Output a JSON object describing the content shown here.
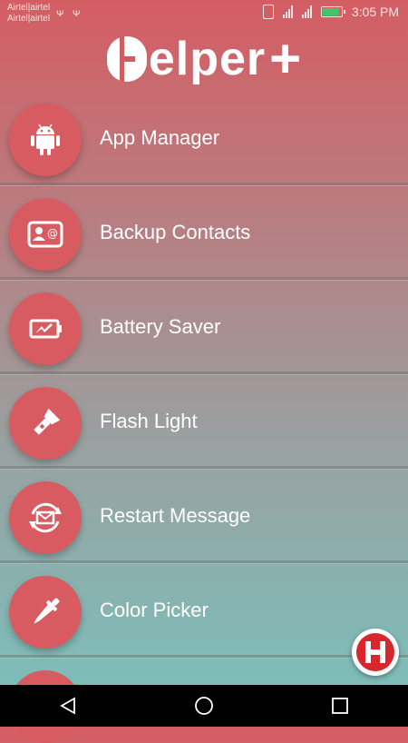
{
  "status_bar": {
    "carrier_line1": "Airtel|airtel",
    "carrier_line2": "Airtel|airtel",
    "usb1": "ᴪ",
    "usb2": "ᴪ",
    "time": "3:05 PM"
  },
  "logo": {
    "text": "elper",
    "plus": "+"
  },
  "menu": [
    {
      "label": "App Manager",
      "icon": "android-icon"
    },
    {
      "label": "Backup Contacts",
      "icon": "contact-card-icon"
    },
    {
      "label": "Battery Saver",
      "icon": "battery-icon"
    },
    {
      "label": "Flash Light",
      "icon": "flashlight-icon"
    },
    {
      "label": "Restart Message",
      "icon": "message-refresh-icon"
    },
    {
      "label": "Color Picker",
      "icon": "eyedropper-icon"
    }
  ],
  "colors": {
    "accent": "#d75b60",
    "fab_red": "#d9262c"
  }
}
